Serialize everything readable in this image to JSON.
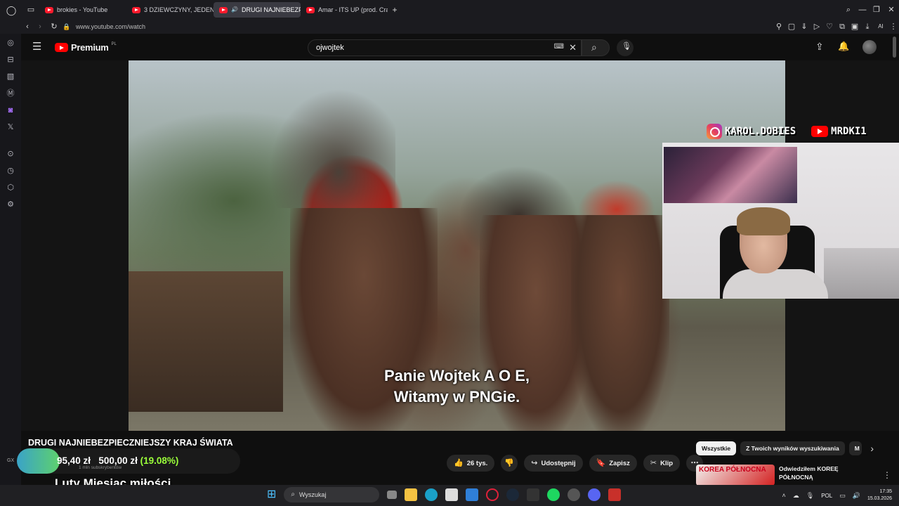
{
  "browser": {
    "tabs": [
      {
        "label": "brokies - YouTube",
        "active": false
      },
      {
        "label": "3 DZIEWCZYNY, JEDEN W",
        "active": false
      },
      {
        "label": "DRUGI NAJNIEBEZPIE",
        "active": true
      },
      {
        "label": "Amar - ITS UP (prod. Crac",
        "active": false
      }
    ],
    "url": "www.youtube.com/watch",
    "ai_label": "AI"
  },
  "youtube": {
    "logo_text": "Premium",
    "logo_region": "PL",
    "search_value": "ojwojtek",
    "keyboard_icon_text": "⌨"
  },
  "video": {
    "subtitle_line1": "Panie Wojtek A O E,",
    "subtitle_line2": "Witamy w PNGie.",
    "overlay_instagram": "KAROL.DOBIES",
    "overlay_youtube": "MRDKI1",
    "title": "DRUGI NAJNIEBEZPIECZNIEJSZY KRAJ ŚWIATA"
  },
  "donation_goal": {
    "current": "95,40 zł",
    "goal": "500,00 zł",
    "percent_text": "(19.08%)",
    "progress_fraction": 0.1908,
    "sub_text": "1 mln subskrybentów",
    "side_label": "GX"
  },
  "stream_overlay_text": "Luty Miesiąc miłości",
  "actions": {
    "likes": "26 tys.",
    "share": "Udostępnij",
    "save": "Zapisz",
    "clip": "Klip"
  },
  "chips": [
    "Wszystkie",
    "Z Twoich wyników wyszukiwania",
    "M"
  ],
  "recommendation": {
    "thumb_text": "KOREA PÓŁNOCNA",
    "title": "Odwiedziłem KOREĘ PÓŁNOCNĄ"
  },
  "taskbar": {
    "search_placeholder": "Wyszukaj",
    "language": "POL",
    "time": "17:35",
    "date": "15.03.2026"
  },
  "colors": {
    "youtube_red": "#ff0000",
    "progress_start": "#3aa3c8",
    "progress_end": "#5ed16d",
    "percent_green": "#9bff3a"
  }
}
